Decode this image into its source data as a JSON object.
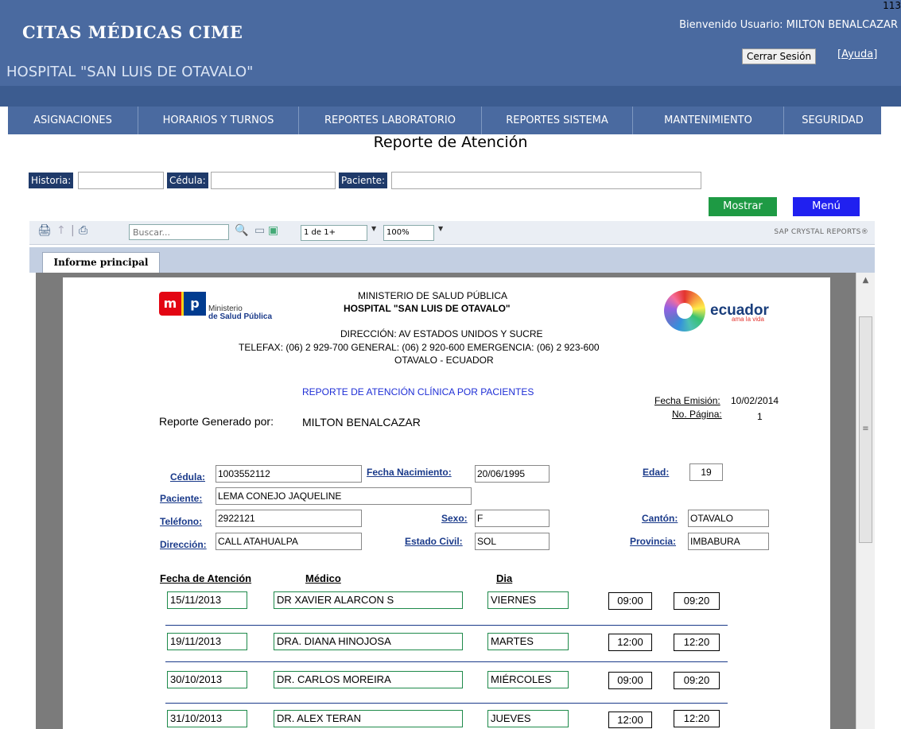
{
  "header": {
    "brand": "CITAS MÉDICAS CIME",
    "hospital": "HOSPITAL \"SAN LUIS DE OTAVALO\"",
    "welcome": "Bienvenido Usuario: MILTON BENALCAZAR",
    "logout_label": "Cerrar Sesión",
    "help_label": "[Ayuda]",
    "corner": "113"
  },
  "nav": [
    "ASIGNACIONES",
    "HORARIOS Y TURNOS",
    "REPORTES LABORATORIO",
    "REPORTES SISTEMA",
    "MANTENIMIENTO",
    "SEGURIDAD"
  ],
  "page_title": "Reporte de Atención",
  "filters": {
    "historia_label": "Historia:",
    "historia_value": "",
    "cedula_label": "Cédula:",
    "cedula_value": "",
    "paciente_label": "Paciente:",
    "paciente_value": "",
    "show_button": "Mostrar",
    "menu_button": "Menú"
  },
  "viewer": {
    "search_placeholder": "Buscar...",
    "page_nav": "1 de 1+",
    "zoom": "100%",
    "vendor": "SAP CRYSTAL REPORTS®",
    "tab_label": "Informe principal"
  },
  "report": {
    "msp_line1": "Ministerio",
    "msp_line2": "de Salud Pública",
    "ministry": "MINISTERIO DE SALUD PÚBLICA",
    "hospital": "HOSPITAL \"SAN LUIS DE OTAVALO\"",
    "address": "DIRECCIÓN: AV ESTADOS UNIDOS Y SUCRE",
    "phones": "TELEFAX: (06) 2 929-700    GENERAL: (06) 2 920-600   EMERGENCIA: (06) 2 923-600",
    "city": "OTAVALO - ECUADOR",
    "ecuador_logo": "ecuador",
    "ecuador_tagline": "ama la vida",
    "report_name": "REPORTE  DE ATENCIÓN CLÍNICA POR PACIENTES",
    "emission_label": "Fecha Emisión:",
    "emission_date": "10/02/2014",
    "page_label": "No. Página:",
    "page_number": "1",
    "generated_label": "Reporte Generado por:",
    "generated_by": "MILTON BENALCAZAR"
  },
  "patient": {
    "cedula_label": "Cédula:",
    "cedula": "1003552112",
    "dob_label": "Fecha Nacimiento:",
    "dob": "20/06/1995",
    "age_label": "Edad:",
    "age": "19",
    "name_label": "Paciente:",
    "name": "LEMA CONEJO  JAQUELINE",
    "phone_label": "Teléfono:",
    "phone": "2922121",
    "sex_label": "Sexo:",
    "sex": "F",
    "canton_label": "Cantón:",
    "canton": "OTAVALO",
    "address_label": "Dirección:",
    "address": "CALL ATAHUALPA",
    "civil_label": "Estado Civil:",
    "civil": "SOL",
    "province_label": "Provincia:",
    "province": "IMBABURA"
  },
  "appointments": {
    "col_date": "Fecha de Atención",
    "col_doctor": "Médico",
    "col_day": "Dia",
    "rows": [
      {
        "date": "15/11/2013",
        "doctor": "DR XAVIER ALARCON S",
        "day": "VIERNES",
        "start": "09:00",
        "end": "09:20"
      },
      {
        "date": "19/11/2013",
        "doctor": "DRA. DIANA HINOJOSA",
        "day": "MARTES",
        "start": "12:00",
        "end": "12:20"
      },
      {
        "date": "30/10/2013",
        "doctor": "DR. CARLOS MOREIRA",
        "day": "MIÉRCOLES",
        "start": "09:00",
        "end": "09:20"
      },
      {
        "date": "31/10/2013",
        "doctor": "DR. ALEX TERAN",
        "day": "JUEVES",
        "start": "12:00",
        "end": "12:20"
      }
    ]
  }
}
